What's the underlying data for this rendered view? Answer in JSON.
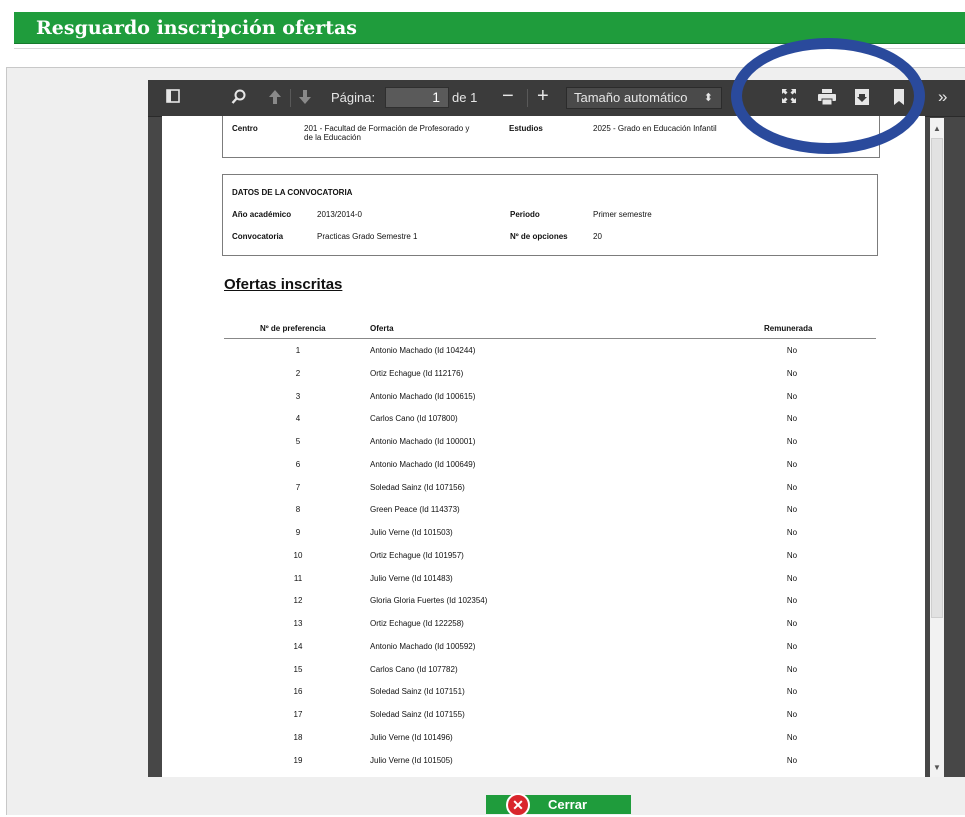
{
  "header": {
    "title": "Resguardo inscripción ofertas"
  },
  "toolbar": {
    "page_label": "Página:",
    "page_value": "1",
    "page_of": "de 1",
    "zoom_value": "Tamaño automático"
  },
  "doc": {
    "centro_label": "Centro",
    "centro_value_line1": "201 - Facultad de Formación de Profesorado y",
    "centro_value_line2": "de la Educación",
    "estudios_label": "Estudios",
    "estudios_value": "2025 - Grado en Educación Infantil",
    "convocatoria_heading": "DATOS DE LA CONVOCATORIA",
    "anio_label": "Año académico",
    "anio_value": "2013/2014-0",
    "periodo_label": "Periodo",
    "periodo_value": "Primer semestre",
    "conv_label": "Convocatoria",
    "conv_value": "Practicas Grado Semestre 1",
    "opciones_label": "Nº de opciones",
    "opciones_value": "20",
    "section_title": "Ofertas inscritas",
    "columns": {
      "pref": "Nº de preferencia",
      "oferta": "Oferta",
      "remun": "Remunerada"
    },
    "rows": [
      {
        "n": "1",
        "oferta": "Antonio Machado (Id 104244)",
        "remun": "No"
      },
      {
        "n": "2",
        "oferta": "Ortiz Echague (Id 112176)",
        "remun": "No"
      },
      {
        "n": "3",
        "oferta": "Antonio Machado (Id 100615)",
        "remun": "No"
      },
      {
        "n": "4",
        "oferta": "Carlos Cano (Id 107800)",
        "remun": "No"
      },
      {
        "n": "5",
        "oferta": "Antonio Machado (Id 100001)",
        "remun": "No"
      },
      {
        "n": "6",
        "oferta": "Antonio Machado (Id 100649)",
        "remun": "No"
      },
      {
        "n": "7",
        "oferta": "Soledad Sainz (Id 107156)",
        "remun": "No"
      },
      {
        "n": "8",
        "oferta": "Green Peace (Id 114373)",
        "remun": "No"
      },
      {
        "n": "9",
        "oferta": "Julio Verne (Id 101503)",
        "remun": "No"
      },
      {
        "n": "10",
        "oferta": "Ortiz Echague (Id 101957)",
        "remun": "No"
      },
      {
        "n": "11",
        "oferta": "Julio Verne (Id 101483)",
        "remun": "No"
      },
      {
        "n": "12",
        "oferta": "Gloria Gloria Fuertes (Id 102354)",
        "remun": "No"
      },
      {
        "n": "13",
        "oferta": "Ortiz Echague (Id 122258)",
        "remun": "No"
      },
      {
        "n": "14",
        "oferta": "Antonio Machado (Id 100592)",
        "remun": "No"
      },
      {
        "n": "15",
        "oferta": "Carlos Cano (Id 107782)",
        "remun": "No"
      },
      {
        "n": "16",
        "oferta": "Soledad Sainz (Id 107151)",
        "remun": "No"
      },
      {
        "n": "17",
        "oferta": "Soledad Sainz (Id 107155)",
        "remun": "No"
      },
      {
        "n": "18",
        "oferta": "Julio Verne (Id 101496)",
        "remun": "No"
      },
      {
        "n": "19",
        "oferta": "Julio Verne (Id 101505)",
        "remun": "No"
      }
    ]
  },
  "footer": {
    "close_label": "Cerrar"
  },
  "colors": {
    "header_green": "#1f9c3c",
    "annotation_oval": "#2a4a9c",
    "close_icon": "#d9262c"
  },
  "icons": [
    "sidebar-toggle-icon",
    "search-icon",
    "previous-page-icon",
    "next-page-icon",
    "zoom-out-icon",
    "zoom-in-icon",
    "presentation-mode-icon",
    "print-icon",
    "download-icon",
    "bookmark-icon",
    "tools-chevron-icon",
    "close-icon"
  ]
}
